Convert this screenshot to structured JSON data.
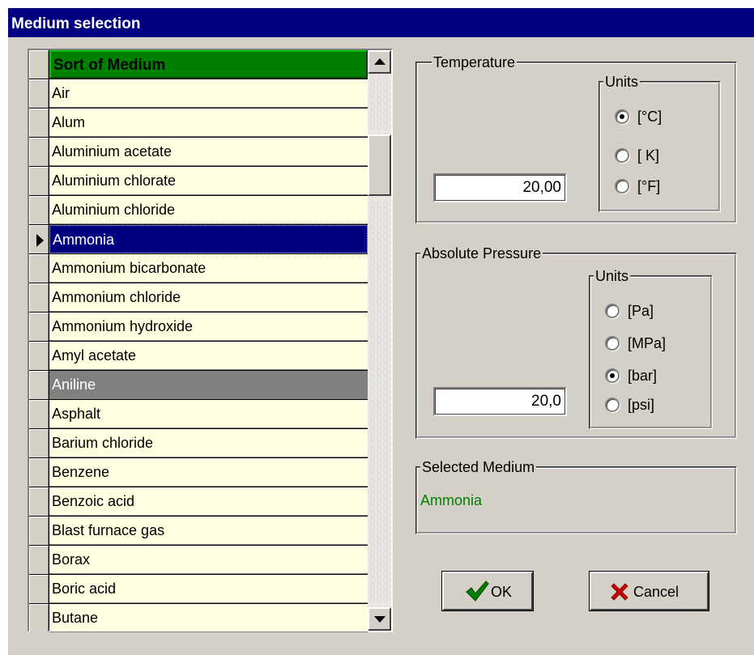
{
  "window": {
    "title": "Medium selection"
  },
  "grid": {
    "header": "Sort of Medium",
    "rows": [
      "Air",
      "Alum",
      "Aluminium acetate",
      "Aluminium chlorate",
      "Aluminium chloride",
      "Ammonia",
      "Ammonium bicarbonate",
      "Ammonium chloride",
      "Ammonium hydroxide",
      "Amyl acetate",
      "Aniline",
      "Asphalt",
      "Barium chloride",
      "Benzene",
      "Benzoic acid",
      "Blast furnace gas",
      "Borax",
      "Boric acid",
      "Butane"
    ],
    "selected_row": "Ammonia",
    "grayed_row": "Aniline",
    "scroll_position_fraction": 0.13
  },
  "temperature": {
    "label": "Temperature",
    "value": "20,00",
    "units_label": "Units",
    "units": [
      {
        "label": "[°C]",
        "checked": true
      },
      {
        "label": "[ K]",
        "checked": false
      },
      {
        "label": "[°F]",
        "checked": false
      }
    ]
  },
  "pressure": {
    "label": "Absolute Pressure",
    "value": "20,0",
    "units_label": "Units",
    "units": [
      {
        "label": "[Pa]",
        "checked": false
      },
      {
        "label": "[MPa]",
        "checked": false
      },
      {
        "label": "[bar]",
        "checked": true
      },
      {
        "label": "[psi]",
        "checked": false
      }
    ]
  },
  "selected_medium": {
    "label": "Selected Medium",
    "value": "Ammonia"
  },
  "buttons": {
    "ok": "OK",
    "cancel": "Cancel"
  },
  "colors": {
    "title_bar": "#000080",
    "grid_header": "#008000",
    "grid_row": "#ffffe1",
    "selected_row": "#000080",
    "grayed_row": "#808080",
    "selected_medium_text": "#008000",
    "ok_icon": "#008000",
    "cancel_icon": "#cc0000"
  },
  "icons": {
    "ok": "checkmark-icon",
    "cancel": "x-cross-icon"
  }
}
